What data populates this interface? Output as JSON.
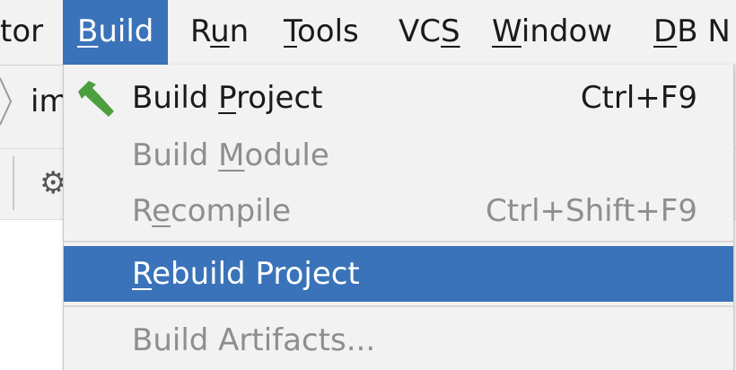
{
  "menubar": {
    "items": [
      {
        "label": "tor",
        "mnemonic": ""
      },
      {
        "pre": "",
        "mn": "B",
        "post": "uild",
        "active": true
      },
      {
        "pre": "R",
        "mn": "u",
        "post": "n"
      },
      {
        "pre": "",
        "mn": "T",
        "post": "ools"
      },
      {
        "pre": "VC",
        "mn": "S",
        "post": ""
      },
      {
        "pre": "",
        "mn": "W",
        "post": "indow"
      },
      {
        "pre": "",
        "mn": "D",
        "post": "B N"
      }
    ]
  },
  "editor": {
    "breadcrumb": "im"
  },
  "build_menu": {
    "items": [
      {
        "pre": "Build ",
        "mn": "P",
        "post": "roject",
        "shortcut": "Ctrl+F9",
        "enabled": true,
        "icon": "hammer-icon"
      },
      {
        "pre": "Build ",
        "mn": "M",
        "post": "odule",
        "shortcut": "",
        "enabled": false
      },
      {
        "pre": "R",
        "mn": "e",
        "post": "compile",
        "shortcut": "Ctrl+Shift+F9",
        "enabled": false
      },
      {
        "pre": "",
        "mn": "R",
        "post": "ebuild Project",
        "shortcut": "",
        "enabled": true,
        "selected": true
      },
      {
        "pre": "Build Artifacts...",
        "mn": "",
        "post": "",
        "shortcut": "",
        "enabled": false
      }
    ]
  },
  "colors": {
    "selection": "#3a73b9",
    "menu_bg": "#f2f2f2",
    "disabled_text": "#8e8e8e",
    "hammer_green": "#4d9e3f"
  }
}
